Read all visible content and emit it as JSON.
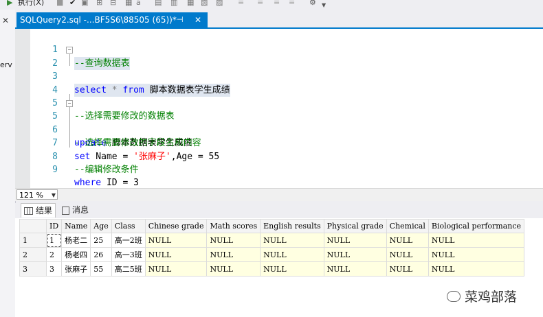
{
  "toolbar": {
    "play_icon": "▶",
    "execute_label": "执行(X)",
    "check_icon": "✔"
  },
  "tab": {
    "title": "SQLQuery2.sql -...BF5S6\\88505 (65))*",
    "pin_icon": "⊣",
    "close_icon": "✕"
  },
  "left_panel": {
    "close_icon": "✕",
    "text": "erv"
  },
  "editor": {
    "lines": [
      {
        "n": "1"
      },
      {
        "n": "2"
      },
      {
        "n": "3"
      },
      {
        "n": "4"
      },
      {
        "n": "5"
      },
      {
        "n": "6"
      },
      {
        "n": "7"
      },
      {
        "n": "8"
      },
      {
        "n": "9"
      }
    ],
    "l1": "--查询数据表",
    "l2_kw1": "select",
    "l2_star": " * ",
    "l2_kw2": "from",
    "l2_tbl": " 脚本数据表学生成绩",
    "l4": "--选择需要修改的数据表",
    "l5_kw": "update",
    "l5_tbl": " 脚本数据表学生成绩",
    "l6": "--选择需要修改的字段名和内容",
    "l7_kw": "set",
    "l7_a": " Name = ",
    "l7_str": "'张麻子'",
    "l7_b": ",Age = 55",
    "l8": "--编辑修改条件",
    "l9_kw": "where",
    "l9_a": " ID = 3"
  },
  "zoom": {
    "value": "121 %"
  },
  "result_tabs": {
    "results_label": "结果",
    "messages_label": "消息"
  },
  "grid": {
    "headers": [
      "ID",
      "Name",
      "Age",
      "Class",
      "Chinese grade",
      "Math scores",
      "English results",
      "Physical grade",
      "Chemical",
      "Biological performance"
    ],
    "rows": [
      {
        "rn": "1",
        "cells": [
          "1",
          "杨老二",
          "25",
          "高一2班",
          "NULL",
          "NULL",
          "NULL",
          "NULL",
          "NULL",
          "NULL"
        ]
      },
      {
        "rn": "2",
        "cells": [
          "2",
          "杨老四",
          "26",
          "高一3班",
          "NULL",
          "NULL",
          "NULL",
          "NULL",
          "NULL",
          "NULL"
        ]
      },
      {
        "rn": "3",
        "cells": [
          "3",
          "张麻子",
          "55",
          "高二5班",
          "NULL",
          "NULL",
          "NULL",
          "NULL",
          "NULL",
          "NULL"
        ]
      }
    ]
  },
  "watermark": {
    "text": "菜鸡部落"
  }
}
